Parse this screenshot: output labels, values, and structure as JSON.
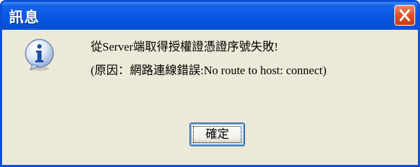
{
  "window": {
    "title": "訊息"
  },
  "titlebar": {
    "close_icon": "close-icon",
    "close_color": "#e0532e",
    "accent": "#0a58e5"
  },
  "message": {
    "icon": "info-icon",
    "line1": "從Server端取得授權證憑證序號失敗!",
    "line2": "(原因：網路連線錯誤:No route to host: connect)"
  },
  "buttons": {
    "ok_label": "確定"
  }
}
